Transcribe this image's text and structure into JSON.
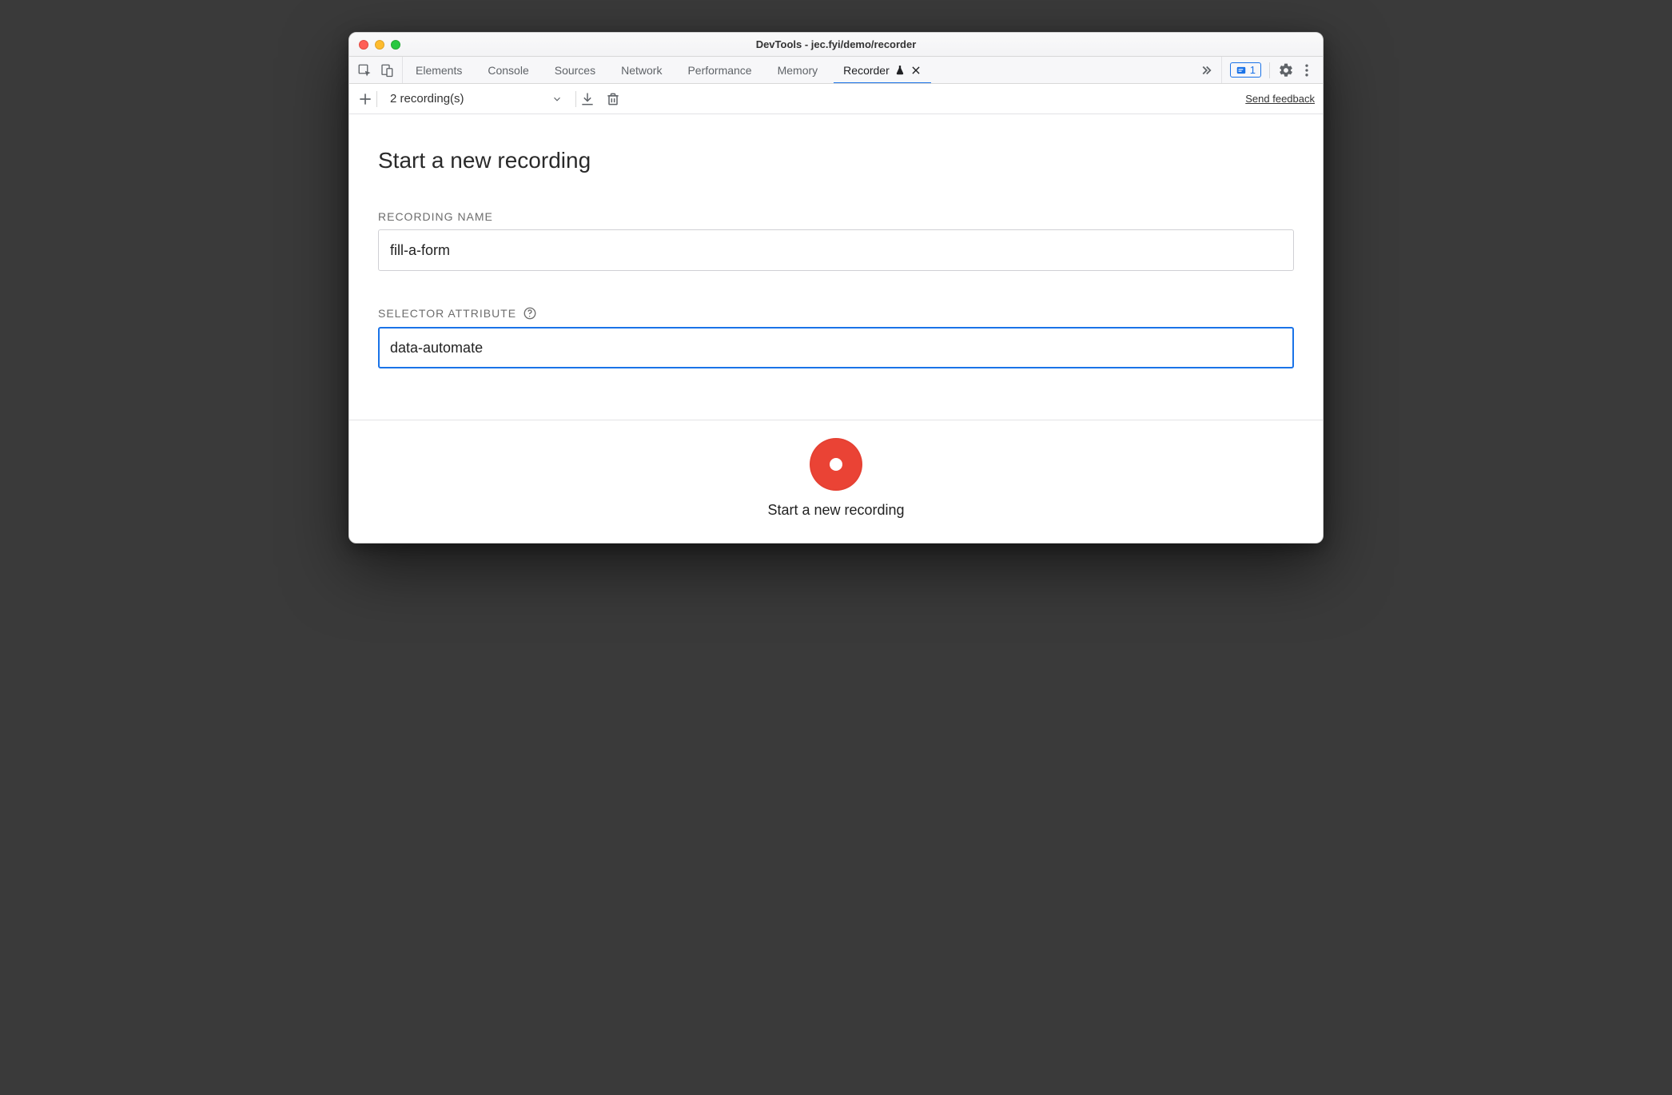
{
  "window": {
    "title": "DevTools - jec.fyi/demo/recorder"
  },
  "tabs": {
    "items": [
      {
        "label": "Elements"
      },
      {
        "label": "Console"
      },
      {
        "label": "Sources"
      },
      {
        "label": "Network"
      },
      {
        "label": "Performance"
      },
      {
        "label": "Memory"
      },
      {
        "label": "Recorder"
      }
    ],
    "active_index": 6,
    "issues_count": "1"
  },
  "toolbar": {
    "dropdown_label": "2 recording(s)",
    "feedback_label": "Send feedback"
  },
  "main": {
    "title": "Start a new recording",
    "fields": {
      "name_label": "RECORDING NAME",
      "name_value": "fill-a-form",
      "selector_label": "SELECTOR ATTRIBUTE",
      "selector_value": "data-automate"
    }
  },
  "footer": {
    "button_label": "Start a new recording"
  }
}
